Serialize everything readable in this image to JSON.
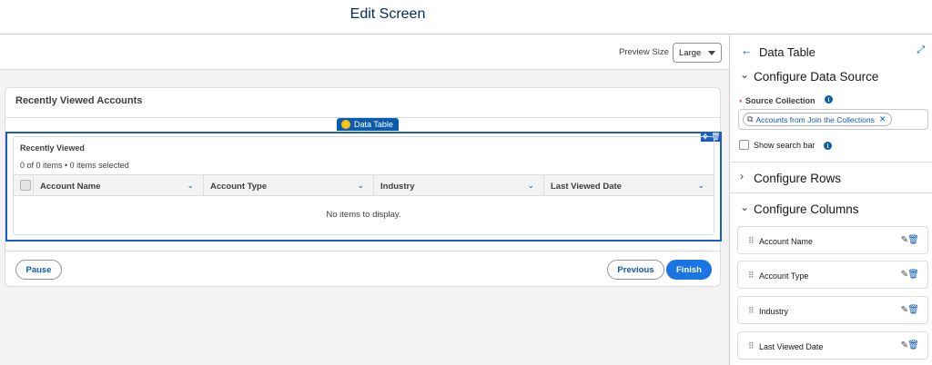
{
  "header": {
    "title": "Edit Screen"
  },
  "preview": {
    "label": "Preview Size",
    "value": "Large"
  },
  "card": {
    "title": "Recently Viewed Accounts",
    "component_badge": "Data Table",
    "table": {
      "title": "Recently Viewed",
      "count_text": "0 of 0 items • 0 items selected",
      "columns": [
        "Account Name",
        "Account Type",
        "Industry",
        "Last Viewed Date"
      ],
      "empty_text": "No items to display."
    },
    "buttons": {
      "pause": "Pause",
      "previous": "Previous",
      "finish": "Finish"
    }
  },
  "panel": {
    "title": "Data Table",
    "sections": {
      "data_source": "Configure Data Source",
      "rows": "Configure Rows",
      "columns": "Configure Columns"
    },
    "source_collection": {
      "required_mark": "*",
      "label": "Source Collection",
      "value": "Accounts from Join the Collections"
    },
    "show_search_bar": {
      "label": "Show search bar",
      "checked": false
    },
    "columns": [
      {
        "label": "Account Name"
      },
      {
        "label": "Account Type"
      },
      {
        "label": "Industry"
      },
      {
        "label": "Last Viewed Date"
      }
    ]
  },
  "icons": {
    "back": "arrow-left-icon",
    "expand": "expand-icon",
    "info": "info-icon",
    "collection": "collection-icon",
    "remove": "close-icon",
    "drag": "drag-handle-icon",
    "edit": "pencil-icon",
    "delete": "trash-icon",
    "move": "move-icon",
    "component": "bolt-icon"
  },
  "colors": {
    "brand": "#1b74e4",
    "selection": "#1b5cc4",
    "link": "#0b5cab"
  }
}
